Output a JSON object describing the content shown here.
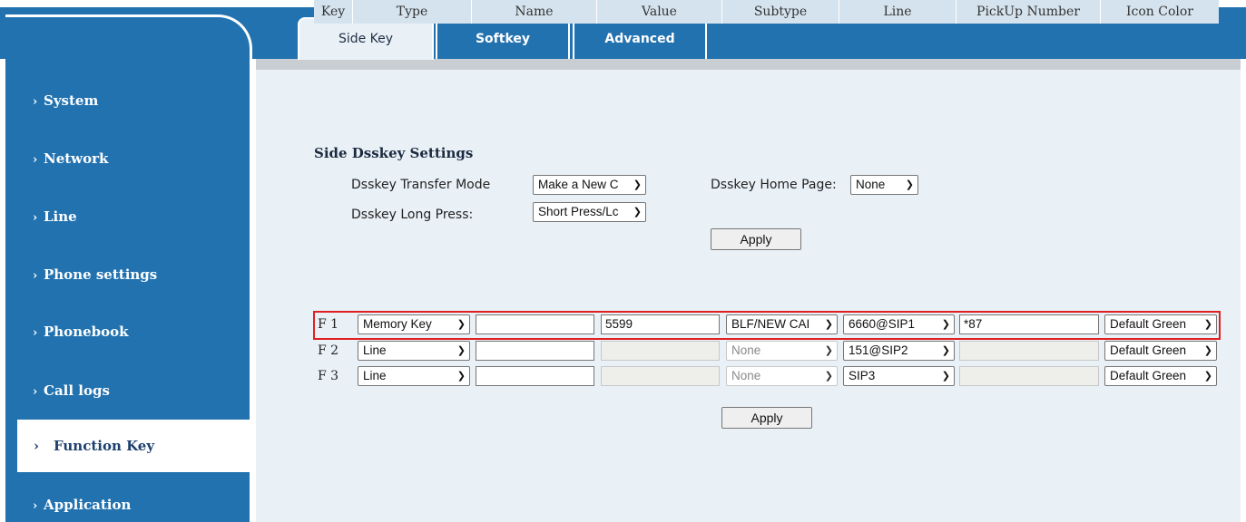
{
  "tabs": [
    "Side Key",
    "Softkey",
    "Advanced"
  ],
  "sidebar": {
    "items": [
      {
        "label": "System"
      },
      {
        "label": "Network"
      },
      {
        "label": "Line"
      },
      {
        "label": "Phone settings"
      },
      {
        "label": "Phonebook"
      },
      {
        "label": "Call logs"
      },
      {
        "label": "Function Key",
        "active": true
      },
      {
        "label": "Application"
      }
    ]
  },
  "settings": {
    "title": "Side Dsskey Settings",
    "transfer_mode_label": "Dsskey Transfer Mode",
    "transfer_mode_value": "Make a New C",
    "home_page_label": "Dsskey Home Page:",
    "home_page_value": "None",
    "long_press_label": "Dsskey Long Press:",
    "long_press_value": "Short Press/Lc",
    "apply_label": "Apply"
  },
  "table": {
    "headers": [
      "Key",
      "Type",
      "Name",
      "Value",
      "Subtype",
      "Line",
      "PickUp Number",
      "Icon Color"
    ],
    "rows": [
      {
        "key": "F 1",
        "type": "Memory Key",
        "name": "",
        "value": "5599",
        "subtype": "BLF/NEW CAI",
        "line": "6660@SIP1",
        "pickup": "*87",
        "icon_color": "Default Green"
      },
      {
        "key": "F 2",
        "type": "Line",
        "name": "",
        "value": "",
        "subtype": "None",
        "line": "151@SIP2",
        "pickup": "",
        "icon_color": "Default Green"
      },
      {
        "key": "F 3",
        "type": "Line",
        "name": "",
        "value": "",
        "subtype": "None",
        "line": "SIP3",
        "pickup": "",
        "icon_color": "Default Green"
      }
    ],
    "apply_label": "Apply"
  },
  "colors": {
    "brand_blue": "#2272b0",
    "panel_bg": "#e9f1f7",
    "highlight_red": "#e02020"
  },
  "icons": {
    "chevron": "chevron-right-icon",
    "select_caret": "chevron-down-icon"
  }
}
